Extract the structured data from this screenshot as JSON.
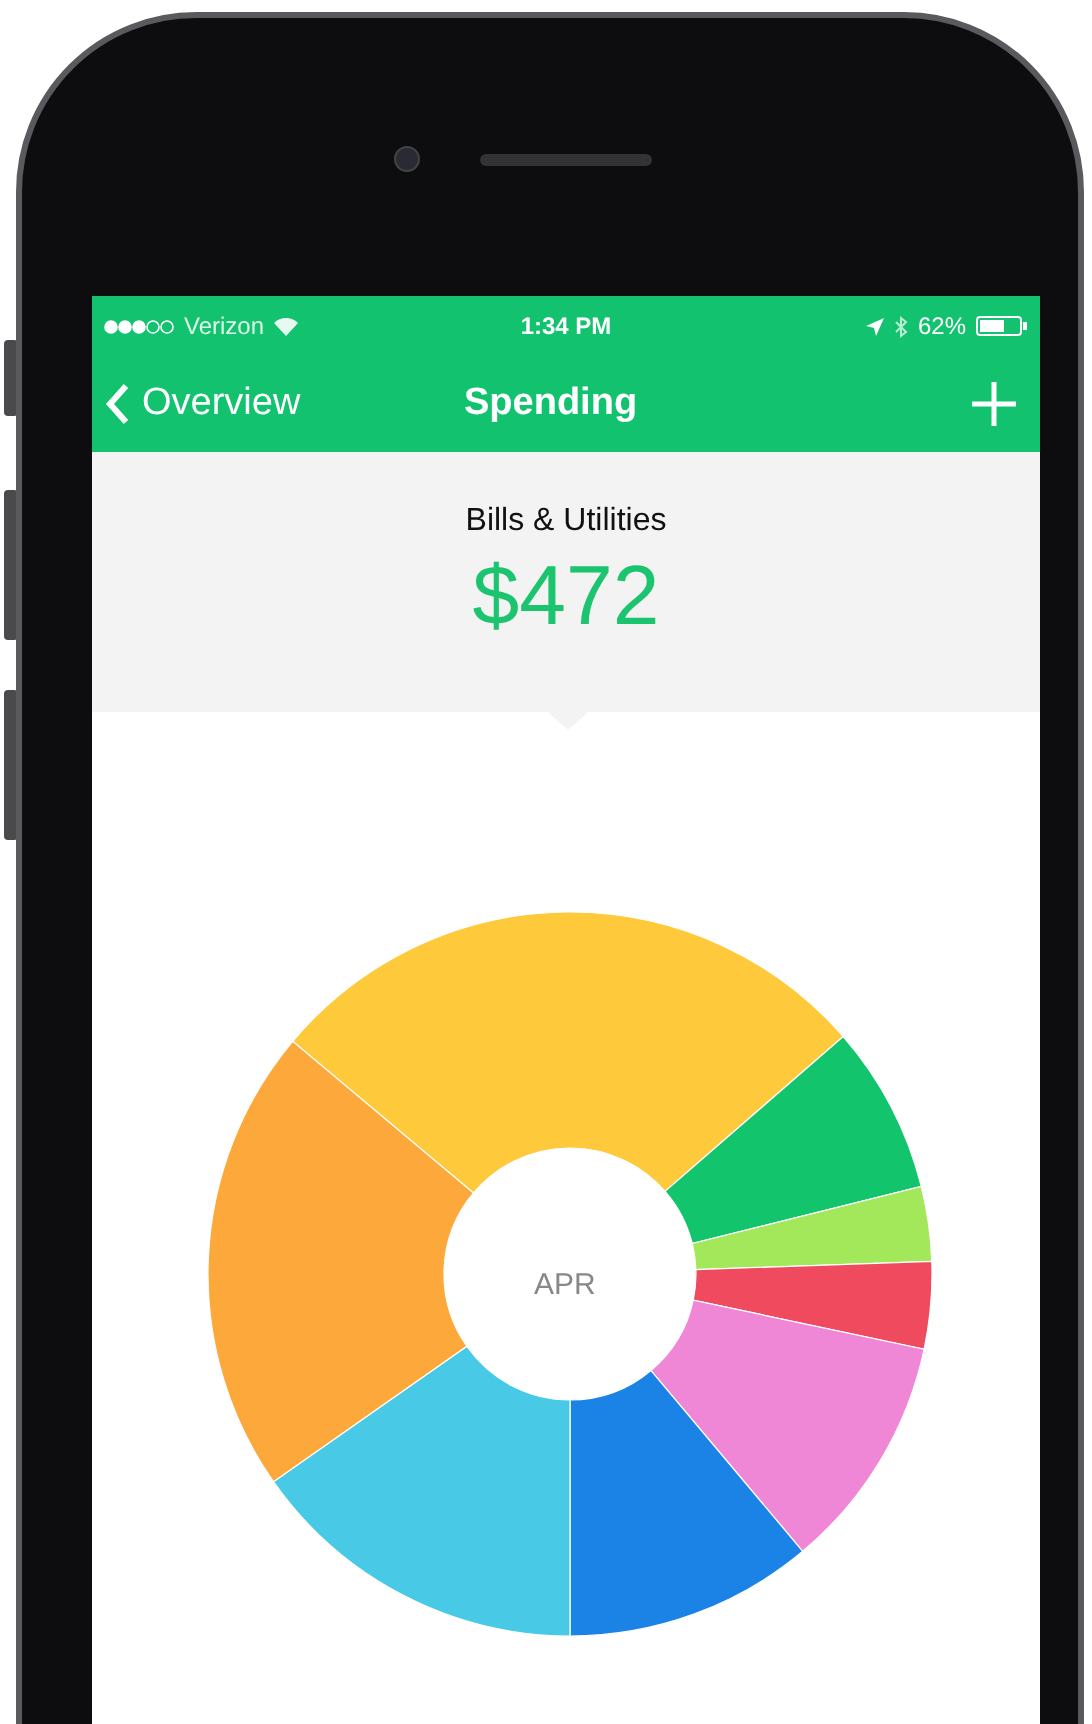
{
  "status_bar": {
    "carrier": "Verizon",
    "time": "1:34 PM",
    "battery": "62%"
  },
  "nav_bar": {
    "back": "Overview",
    "title": "Spending"
  },
  "summary": {
    "category": "Bills & Utilities",
    "amount": "$472"
  },
  "chart": {
    "center_label": "APR"
  }
}
